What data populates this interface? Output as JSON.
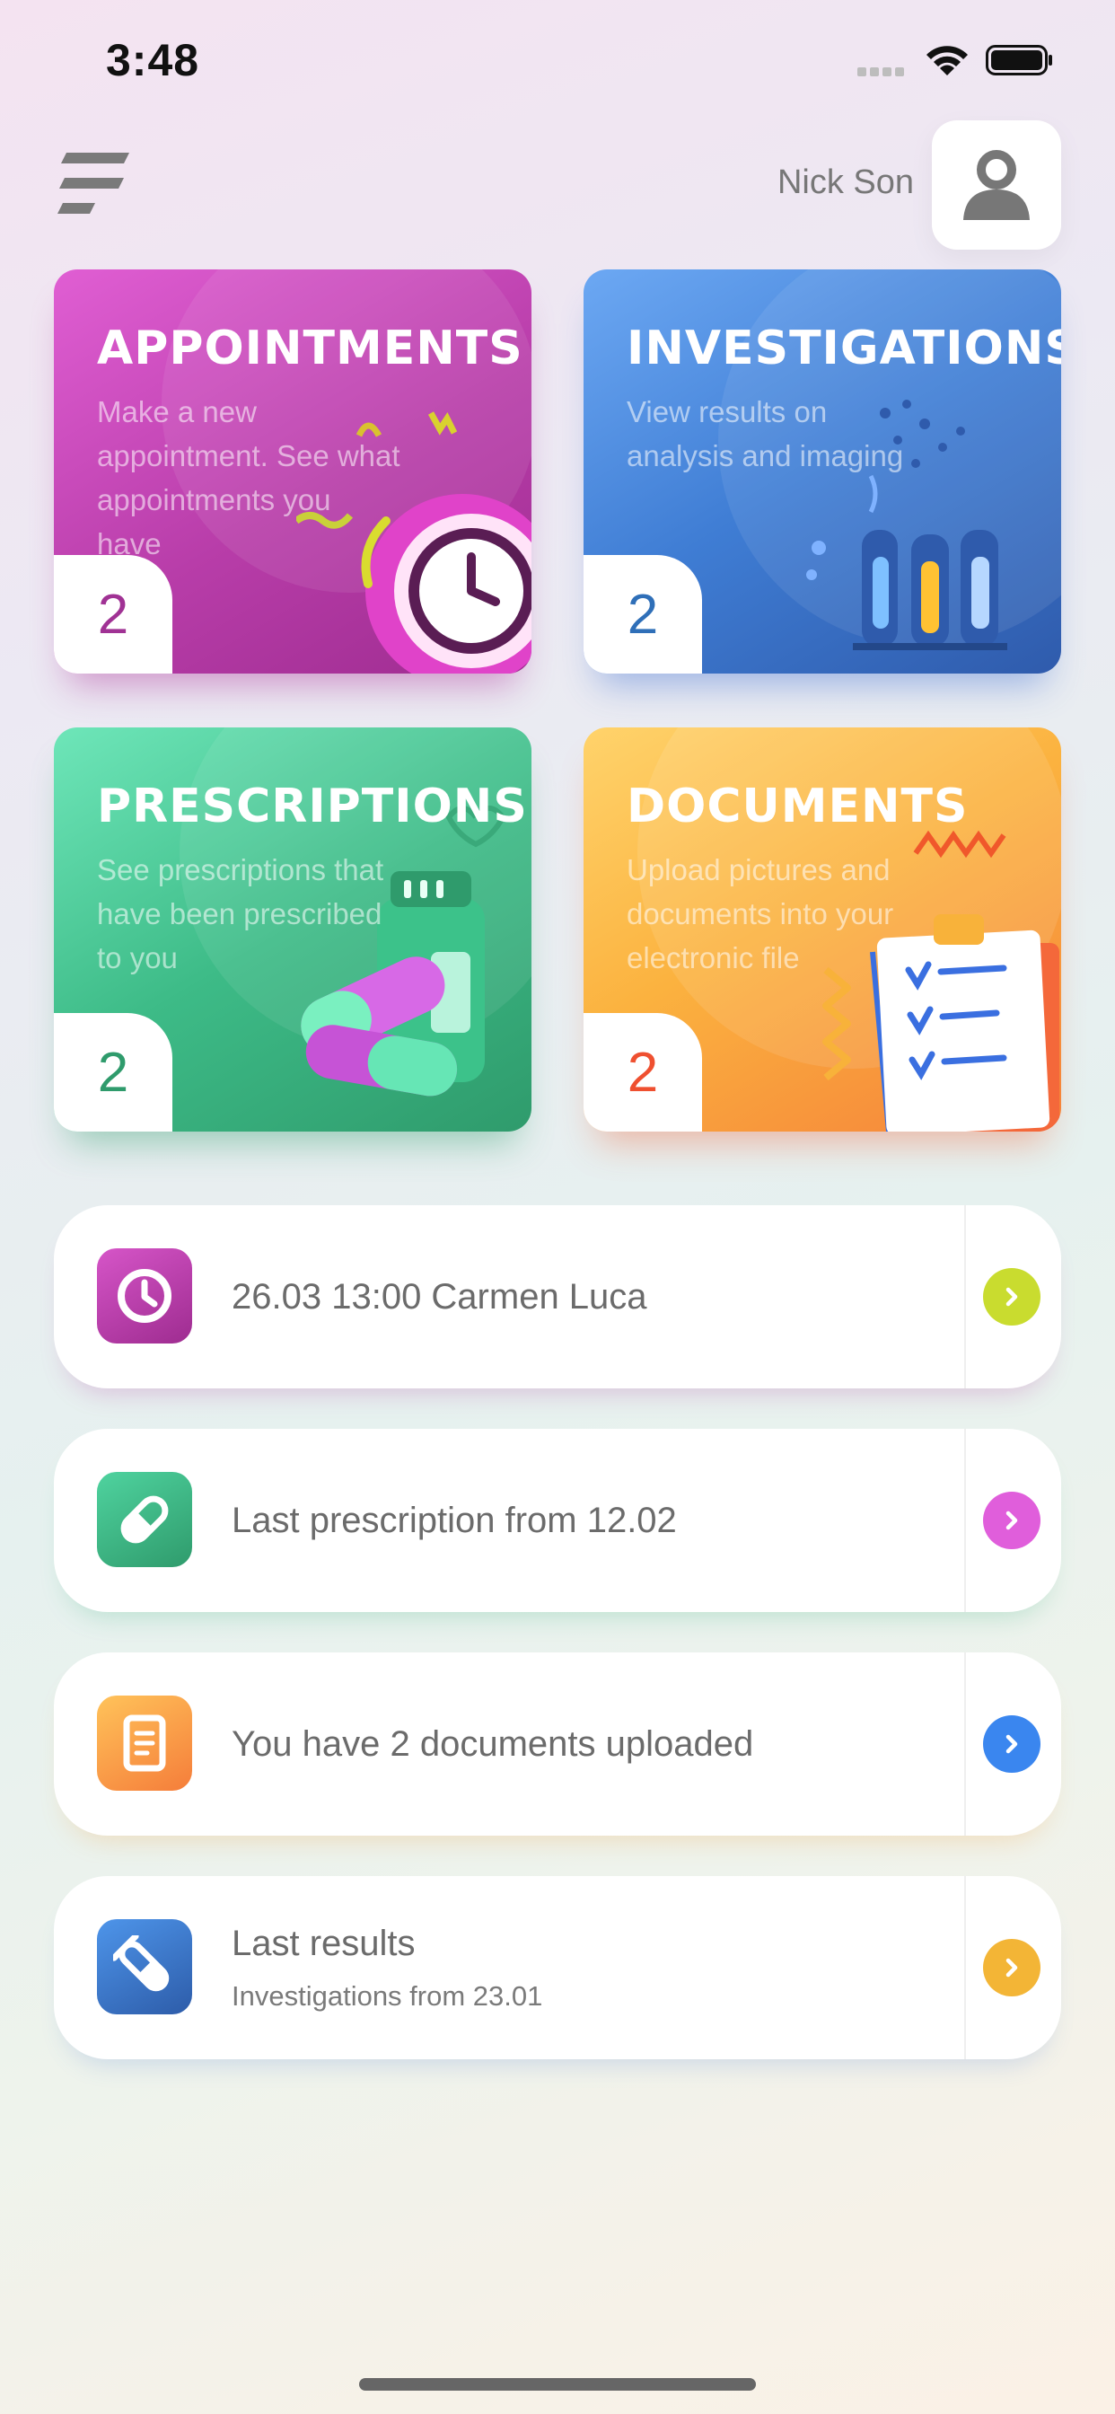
{
  "status_bar": {
    "time": "3:48"
  },
  "header": {
    "user_name": "Nick Son",
    "menu_icon": "menu-icon",
    "avatar_icon": "user-icon"
  },
  "cards": [
    {
      "title": "APPOINTMENTS",
      "description": "Make a new appointment. See what appointments you have",
      "count": "2",
      "accent": "#b83da9"
    },
    {
      "title": "INVESTIGATIONS",
      "description": "View results on analysis and imaging",
      "count": "2",
      "accent": "#3f7dd4"
    },
    {
      "title": "PRESCRIPTIONS",
      "description": "See prescriptions that have been prescribed to you",
      "count": "2",
      "accent": "#3dbb87"
    },
    {
      "title": "DOCUMENTS",
      "description": "Upload pictures and documents into your electronic file",
      "count": "2",
      "accent": "#fbb23f"
    }
  ],
  "list": [
    {
      "icon": "clock-icon",
      "text": "26.03 13:00 Carmen Luca",
      "arrow_color": "#c9dc2f"
    },
    {
      "icon": "pill-icon",
      "text": "Last prescription from 12.02",
      "arrow_color": "#e05edb"
    },
    {
      "icon": "document-icon",
      "text": "You have 2 documents uploaded",
      "arrow_color": "#3a86ef"
    },
    {
      "icon": "test-tube-icon",
      "text": "Last results",
      "subtext": "Investigations from 23.01",
      "arrow_color": "#f3b536"
    }
  ]
}
